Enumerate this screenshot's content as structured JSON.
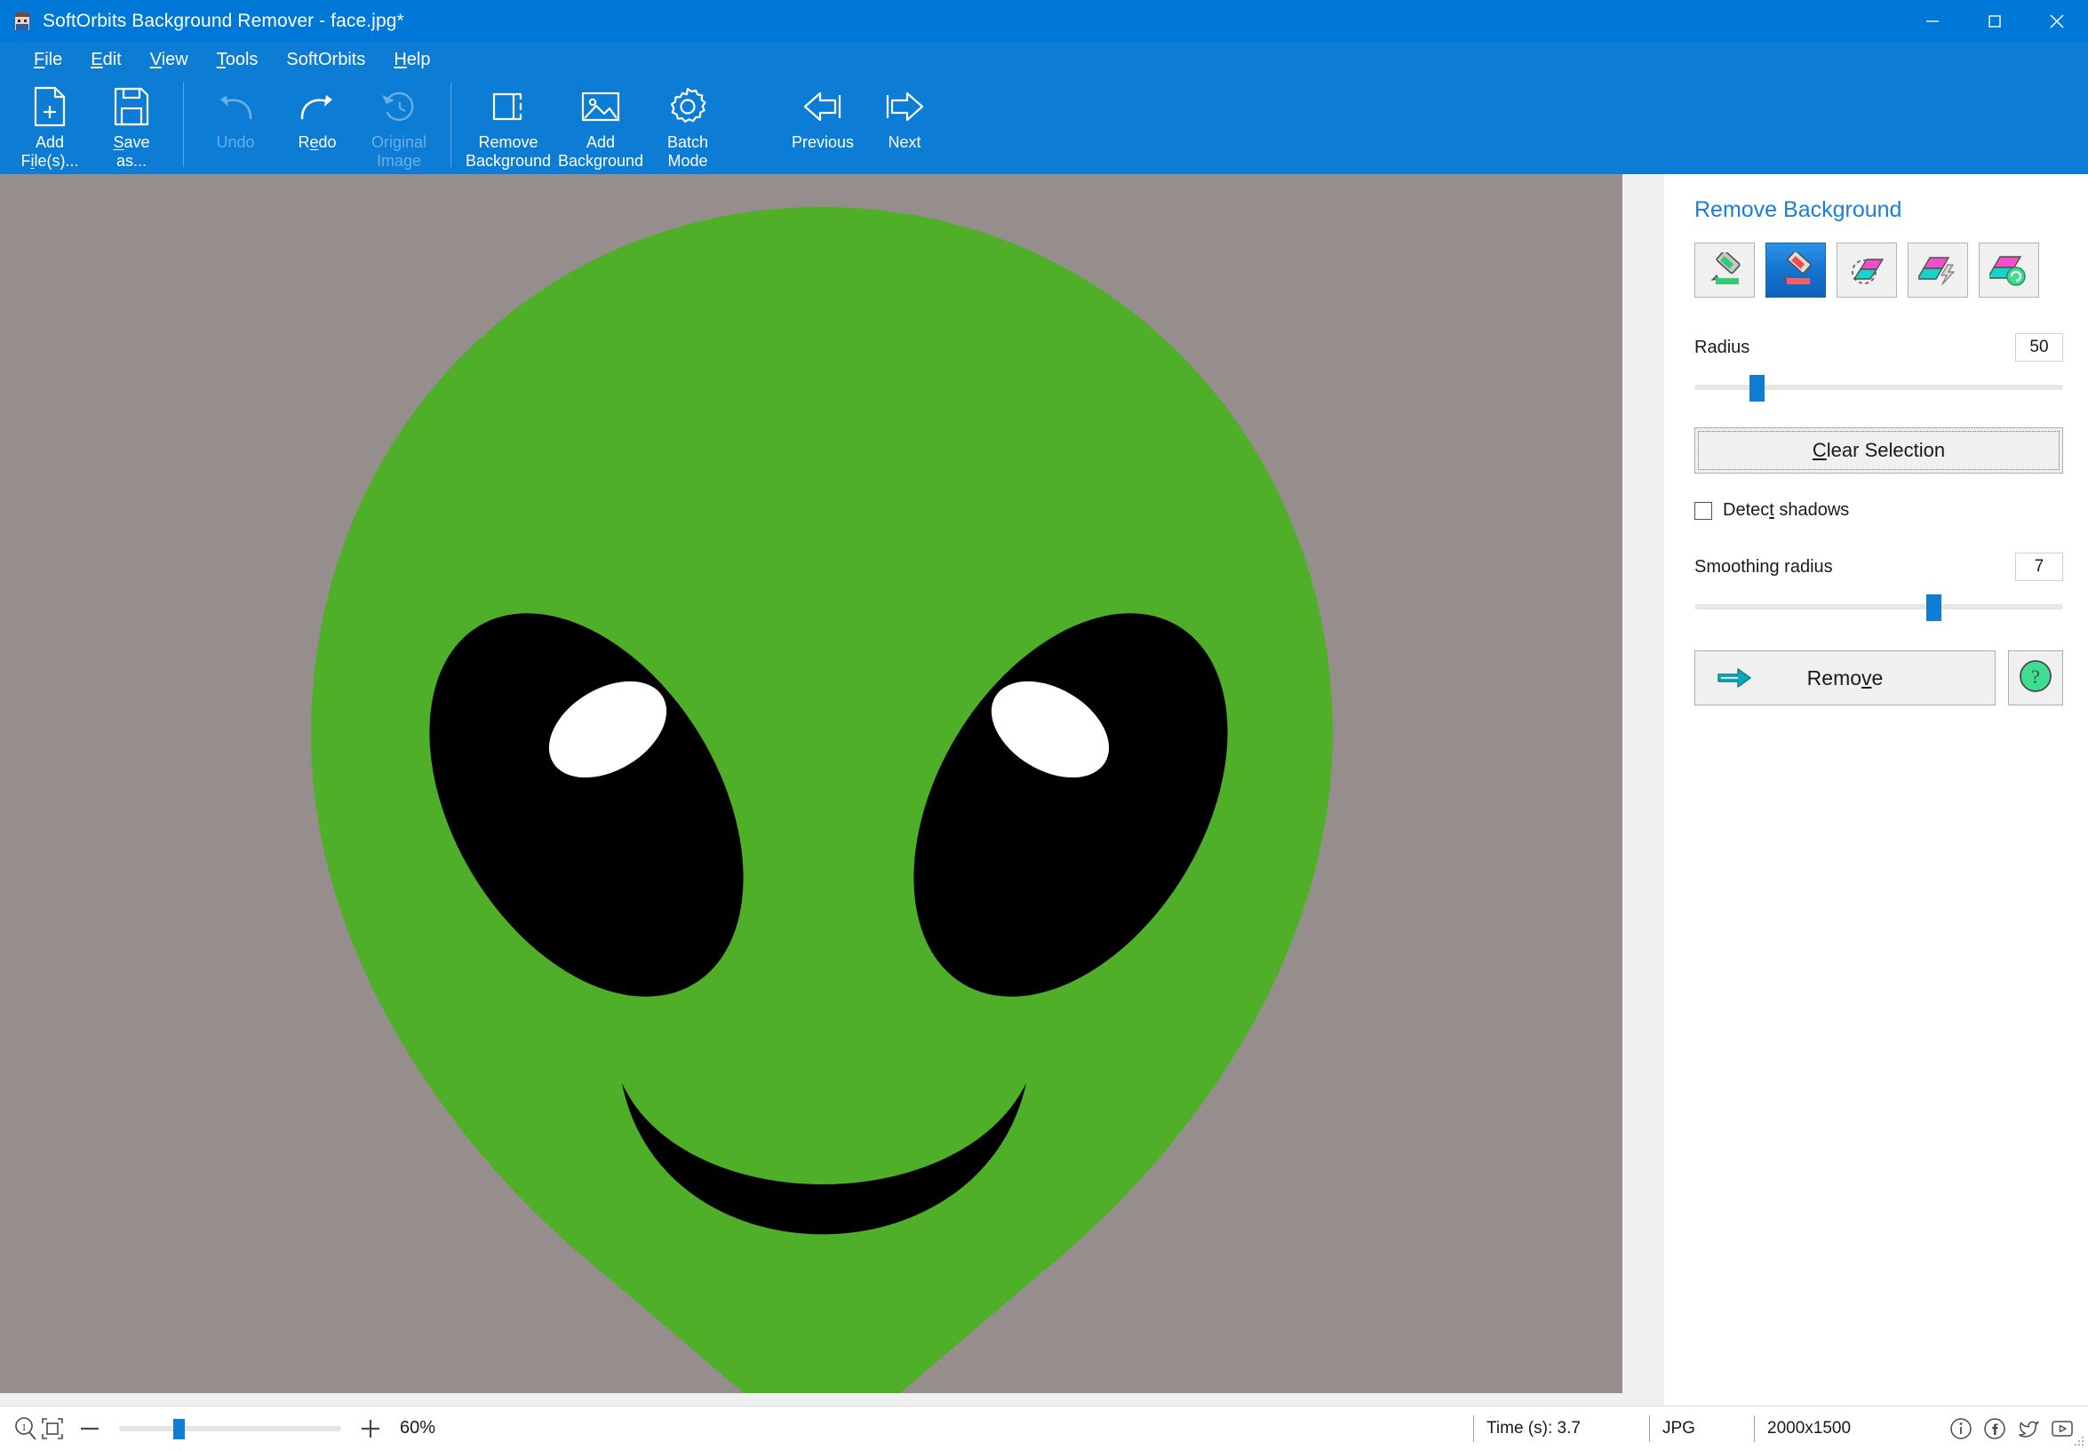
{
  "window": {
    "title": "SoftOrbits Background Remover - face.jpg*",
    "app_icon": "app-icon",
    "controls": {
      "minimize": "minimize-icon",
      "maximize": "maximize-icon",
      "close": "close-icon"
    }
  },
  "menubar": {
    "items": [
      {
        "label": "File",
        "accel": "F"
      },
      {
        "label": "Edit",
        "accel": "E"
      },
      {
        "label": "View",
        "accel": "V"
      },
      {
        "label": "Tools",
        "accel": "T"
      },
      {
        "label": "SoftOrbits",
        "accel": ""
      },
      {
        "label": "Help",
        "accel": "H"
      }
    ]
  },
  "ribbon": {
    "buttons": [
      {
        "id": "add-files",
        "label": "Add\nFile(s)...",
        "icon": "file-plus-icon",
        "enabled": true
      },
      {
        "id": "save-as",
        "label": "Save\nas...",
        "icon": "floppy-disk-icon",
        "enabled": true
      },
      {
        "id": "undo",
        "label": "Undo",
        "icon": "undo-arrow-icon",
        "enabled": false
      },
      {
        "id": "redo",
        "label": "Redo",
        "icon": "redo-arrow-icon",
        "enabled": true
      },
      {
        "id": "original-image",
        "label": "Original\nImage",
        "icon": "history-clock-icon",
        "enabled": false
      },
      {
        "id": "remove-background",
        "label": "Remove\nBackground",
        "icon": "dashed-crop-icon",
        "enabled": true
      },
      {
        "id": "add-background",
        "label": "Add\nBackground",
        "icon": "picture-icon",
        "enabled": true
      },
      {
        "id": "batch-mode",
        "label": "Batch\nMode",
        "icon": "gear-icon",
        "enabled": true
      },
      {
        "id": "previous",
        "label": "Previous",
        "icon": "arrow-left-icon",
        "enabled": true
      },
      {
        "id": "next",
        "label": "Next",
        "icon": "arrow-right-icon",
        "enabled": true
      }
    ]
  },
  "panel": {
    "title": "Remove Background",
    "tools": [
      {
        "id": "mark-keep",
        "icon": "green-marker-icon",
        "selected": false
      },
      {
        "id": "mark-remove",
        "icon": "red-marker-icon",
        "selected": true
      },
      {
        "id": "magic-eraser",
        "icon": "dashed-lasso-eraser-icon",
        "selected": false
      },
      {
        "id": "quick-erase",
        "icon": "lightning-eraser-icon",
        "selected": false
      },
      {
        "id": "restore",
        "icon": "refresh-eraser-icon",
        "selected": false
      }
    ],
    "radius": {
      "label": "Radius",
      "value": "50",
      "percent": 17
    },
    "clear_selection": {
      "label": "Clear Selection",
      "accel": "C"
    },
    "detect_shadows": {
      "label": "Detect shadows",
      "accel": "t",
      "checked": false
    },
    "smoothing_radius": {
      "label": "Smoothing radius",
      "value": "7",
      "percent": 65
    },
    "remove_button": {
      "label": "Remove",
      "accel": "v",
      "icon": "arrow-right-teal-icon"
    },
    "help_button": {
      "icon": "question-mark-icon"
    }
  },
  "canvas": {
    "image_name": "alien-face",
    "background_color": "#968D8D",
    "face_color": "#4FAF28",
    "eye_color": "#000000",
    "highlight_color": "#FFFFFF"
  },
  "statusbar": {
    "zoom_one_to_one_icon": "zoom-actual-size-icon",
    "fit_icon": "fit-to-window-icon",
    "minus_icon": "minus-icon",
    "plus_icon": "plus-icon",
    "zoom_percent": "60%",
    "zoom_slider_percent": 27,
    "time": "Time (s): 3.7",
    "format": "JPG",
    "dimensions": "2000x1500",
    "social": [
      {
        "id": "info",
        "icon": "info-circle-icon"
      },
      {
        "id": "facebook",
        "icon": "facebook-icon"
      },
      {
        "id": "twitter",
        "icon": "twitter-bird-icon"
      },
      {
        "id": "youtube",
        "icon": "youtube-play-icon"
      }
    ]
  },
  "colors": {
    "titlebar": "#0078D7",
    "ribbon": "#0C7CD5",
    "panel_title": "#1A7FD4",
    "accent_blue": "#0F7DD4",
    "canvas_bg": "#968D8D"
  }
}
